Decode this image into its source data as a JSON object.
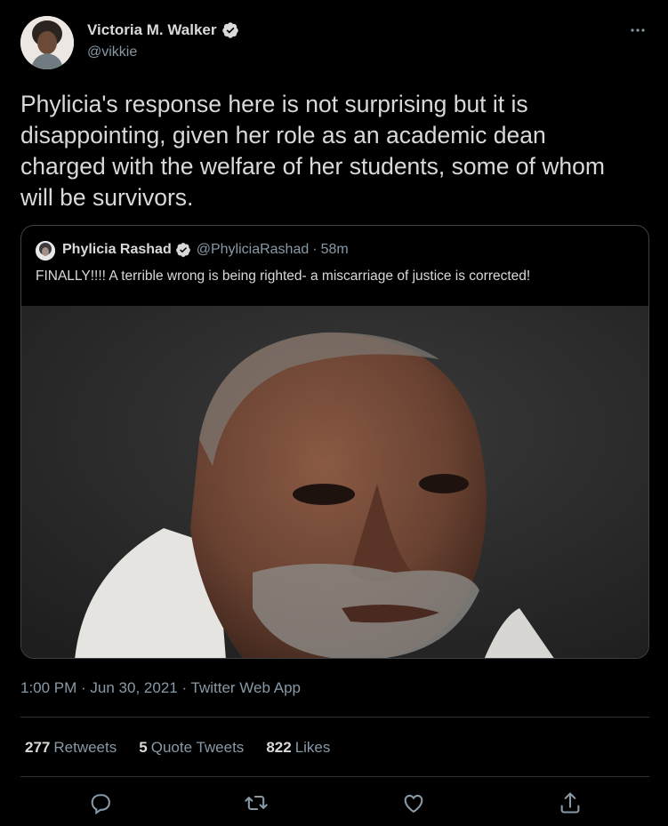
{
  "author": {
    "name": "Victoria M. Walker",
    "handle": "@vikkie"
  },
  "tweet_text": "Phylicia's response here is not surprising but it is disappointing, given her role as an academic dean charged with the welfare of her students, some of whom will be survivors.",
  "quoted": {
    "name": "Phylicia Rashad",
    "handle": "@PhyliciaRashad",
    "separator": "·",
    "time": "58m",
    "text": "FINALLY!!!! A terrible wrong is being righted- a miscarriage of justice is corrected!"
  },
  "meta": "1:00 PM · Jun 30, 2021 · Twitter Web App",
  "stats": {
    "retweets_count": "277",
    "retweets_label": "Retweets",
    "quotes_count": "5",
    "quotes_label": "Quote Tweets",
    "likes_count": "822",
    "likes_label": "Likes"
  },
  "colors": {
    "background": "#000000",
    "primary_text": "#d9d9d9",
    "secondary_text": "#8899a6",
    "border": "#2f3336"
  },
  "icons": [
    "more-icon",
    "verified-icon",
    "reply-icon",
    "retweet-icon",
    "like-icon",
    "share-icon"
  ]
}
